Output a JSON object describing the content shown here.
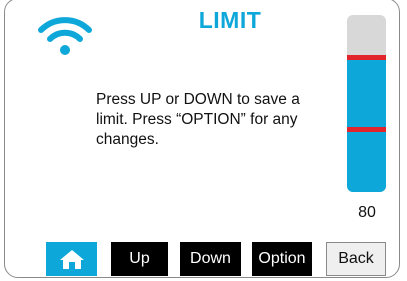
{
  "screen": {
    "title": "LIMIT",
    "message": "Press UP or DOWN to save a limit. Press “OPTION” for any changes."
  },
  "status": {
    "wifi_icon": "wifi-icon"
  },
  "limit_gauge": {
    "value_label": "80",
    "fill_fraction": 0.76,
    "upper_marker_fraction": 0.76,
    "lower_marker_fraction": 0.35,
    "colors": {
      "fill": "#0da7d9",
      "track": "#d8d8d8",
      "marker": "#e2242c"
    }
  },
  "buttons": {
    "home_icon": "home-icon",
    "up": "Up",
    "down": "Down",
    "option": "Option",
    "back": "Back"
  },
  "colors": {
    "accent": "#0da7d9"
  }
}
